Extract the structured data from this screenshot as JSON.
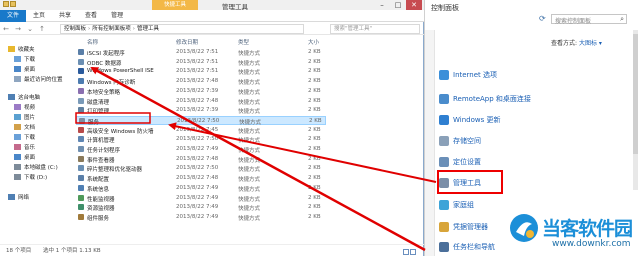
{
  "explorer": {
    "tool_tab": "快捷工具",
    "title": "管理工具",
    "ribbon_tabs": [
      "文件",
      "主页",
      "共享",
      "查看",
      "管理"
    ],
    "address": [
      "控制面板",
      "所有控制面板项",
      "管理工具"
    ],
    "search_placeholder": "搜索\"管理工具\"",
    "columns": {
      "name": "名称",
      "date": "修改日期",
      "type": "类型",
      "size": "大小"
    },
    "nav": [
      {
        "label": "收藏夹",
        "icon": "star-icon"
      },
      {
        "label": "下载",
        "icon": "download-folder-icon"
      },
      {
        "label": "桌面",
        "icon": "desktop-icon"
      },
      {
        "label": "最近访问的位置",
        "icon": "recent-places-icon"
      },
      {
        "label": "这台电脑",
        "icon": "computer-icon"
      },
      {
        "label": "视频",
        "icon": "video-folder-icon"
      },
      {
        "label": "图片",
        "icon": "pictures-folder-icon"
      },
      {
        "label": "文档",
        "icon": "documents-folder-icon"
      },
      {
        "label": "下载",
        "icon": "download-folder-icon"
      },
      {
        "label": "音乐",
        "icon": "music-folder-icon"
      },
      {
        "label": "桌面",
        "icon": "desktop-icon"
      },
      {
        "label": "本地磁盘 (C:)",
        "icon": "drive-icon"
      },
      {
        "label": "下载 (D:)",
        "icon": "drive-icon"
      },
      {
        "label": "网络",
        "icon": "network-icon"
      }
    ],
    "files": [
      {
        "name": "iSCSI 发起程序",
        "date": "2013/8/22 7:51",
        "type": "快捷方式",
        "size": "2 KB"
      },
      {
        "name": "ODBC 数据源",
        "date": "2013/8/22 7:51",
        "type": "快捷方式",
        "size": "2 KB"
      },
      {
        "name": "Windows PowerShell ISE",
        "date": "2013/8/22 7:51",
        "type": "快捷方式",
        "size": "2 KB"
      },
      {
        "name": "Windows 内存诊断",
        "date": "2013/8/22 7:48",
        "type": "快捷方式",
        "size": "2 KB"
      },
      {
        "name": "本地安全策略",
        "date": "2013/8/22 7:39",
        "type": "快捷方式",
        "size": "2 KB"
      },
      {
        "name": "磁盘清理",
        "date": "2013/8/22 7:48",
        "type": "快捷方式",
        "size": "2 KB"
      },
      {
        "name": "打印管理",
        "date": "2013/8/22 7:39",
        "type": "快捷方式",
        "size": "2 KB"
      },
      {
        "name": "服务",
        "date": "2013/8/22 7:50",
        "type": "快捷方式",
        "size": "2 KB"
      },
      {
        "name": "高级安全 Windows 防火墙",
        "date": "2013/8/22 7:45",
        "type": "快捷方式",
        "size": "2 KB"
      },
      {
        "name": "计算机管理",
        "date": "2013/8/22 7:50",
        "type": "快捷方式",
        "size": "2 KB"
      },
      {
        "name": "任务计划程序",
        "date": "2013/8/22 7:49",
        "type": "快捷方式",
        "size": "2 KB"
      },
      {
        "name": "事件查看器",
        "date": "2013/8/22 7:48",
        "type": "快捷方式",
        "size": "2 KB"
      },
      {
        "name": "碎片整理和优化驱动器",
        "date": "2013/8/22 7:50",
        "type": "快捷方式",
        "size": "2 KB"
      },
      {
        "name": "系统配置",
        "date": "2013/8/22 7:48",
        "type": "快捷方式",
        "size": "2 KB"
      },
      {
        "name": "系统信息",
        "date": "2013/8/22 7:49",
        "type": "快捷方式",
        "size": "2 KB"
      },
      {
        "name": "性能监视器",
        "date": "2013/8/22 7:49",
        "type": "快捷方式",
        "size": "2 KB"
      },
      {
        "name": "资源监视器",
        "date": "2013/8/22 7:49",
        "type": "快捷方式",
        "size": "2 KB"
      },
      {
        "name": "组件服务",
        "date": "2013/8/22 7:49",
        "type": "快捷方式",
        "size": "2 KB"
      }
    ],
    "status_count": "18 个项目",
    "status_selected": "选中 1 个项目  1.13 KB"
  },
  "control_panel": {
    "title": "控制面板",
    "search_placeholder": "搜索控制面板",
    "view_by": "查看方式:",
    "view_value": "大图标 ▾",
    "items": [
      {
        "label": "Internet 选项",
        "icon": "internet-options-icon",
        "color": "#3b8fd9"
      },
      {
        "label": "RemoteApp 和桌面连接",
        "icon": "remoteapp-icon",
        "color": "#4a8ccc"
      },
      {
        "label": "Windows 更新",
        "icon": "windows-update-icon",
        "color": "#2f7fd1"
      },
      {
        "label": "存储空间",
        "icon": "storage-spaces-icon",
        "color": "#8aa0b8"
      },
      {
        "label": "定位设置",
        "icon": "location-icon",
        "color": "#6a8fb8"
      },
      {
        "label": "管理工具",
        "icon": "admin-tools-icon",
        "color": "#7a8ea8"
      },
      {
        "label": "家庭组",
        "icon": "homegroup-icon",
        "color": "#3da4d8"
      },
      {
        "label": "凭据管理器",
        "icon": "credential-manager-icon",
        "color": "#d8a53a"
      },
      {
        "label": "任务栏和导航",
        "icon": "taskbar-icon",
        "color": "#4b6f9a"
      }
    ]
  },
  "watermark": {
    "text": "当客软件园",
    "url": "www.downkr.com",
    "color": "#1c8fd8"
  },
  "colors": {
    "highlight": "#e00000",
    "selection": "#cce8ff",
    "accent": "#1979ca"
  }
}
